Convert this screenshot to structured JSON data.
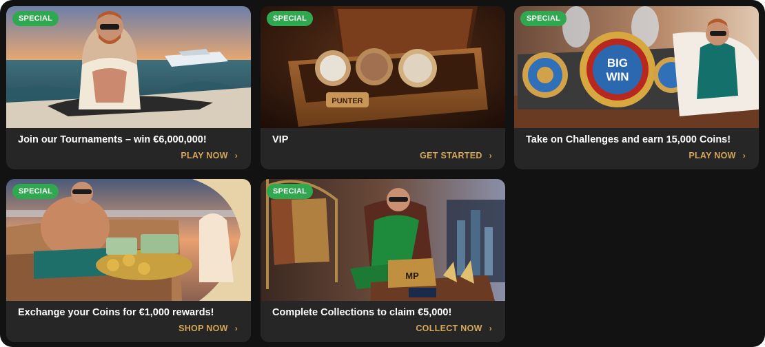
{
  "colors": {
    "badge": "#2fa84f",
    "cta": "#d5a85a",
    "card": "#262626",
    "page": "#121212"
  },
  "cards": [
    {
      "badge": "SPECIAL",
      "title": "Join our Tournaments – win €6,000,000!",
      "cta": "PLAY NOW",
      "icon": "chevron-right-icon"
    },
    {
      "badge": "SPECIAL",
      "title": "VIP",
      "cta": "GET STARTED",
      "icon": "chevron-right-icon",
      "image_text": "PUNTER"
    },
    {
      "badge": "SPECIAL",
      "title": "Take on Challenges and earn 15,000 Coins!",
      "cta": "PLAY NOW",
      "icon": "chevron-right-icon",
      "image_text": "BIG WIN"
    },
    {
      "badge": "SPECIAL",
      "title": "Exchange your Coins for €1,000 rewards!",
      "cta": "SHOP NOW",
      "icon": "chevron-right-icon"
    },
    {
      "badge": "SPECIAL",
      "title": "Complete Collections to claim €5,000!",
      "cta": "COLLECT NOW",
      "icon": "chevron-right-icon",
      "image_text": "MP"
    }
  ]
}
